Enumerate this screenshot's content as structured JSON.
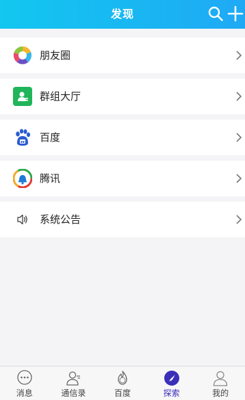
{
  "header": {
    "title": "发现"
  },
  "items": [
    {
      "label": "朋友圈"
    },
    {
      "label": "群组大厅"
    },
    {
      "label": "百度"
    },
    {
      "label": "腾讯"
    },
    {
      "label": "系统公告"
    }
  ],
  "tabs": [
    {
      "label": "消息"
    },
    {
      "label": "通信录"
    },
    {
      "label": "百度"
    },
    {
      "label": "探索"
    },
    {
      "label": "我的"
    }
  ],
  "colors": {
    "header_start": "#12c7f0",
    "header_end": "#1fa9f4",
    "group_green": "#21b55a",
    "active_tab": "#3a2fb8"
  }
}
